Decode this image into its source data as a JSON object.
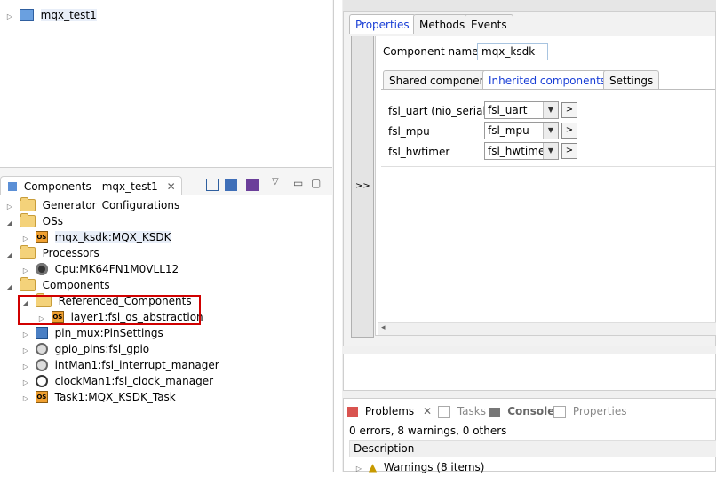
{
  "project_explorer": {
    "project": "mqx_test1"
  },
  "components_view": {
    "title": "Components - mqx_test1",
    "tree": [
      {
        "label": "Generator_Configurations",
        "icon": "folder-icon"
      },
      {
        "label": "OSs",
        "icon": "folder-icon"
      },
      {
        "label": "mqx_ksdk:MQX_KSDK",
        "icon": "os-component-icon"
      },
      {
        "label": "Processors",
        "icon": "folder-icon"
      },
      {
        "label": "Cpu:MK64FN1M0VLL12",
        "icon": "cpu-icon"
      },
      {
        "label": "Components",
        "icon": "folder-icon"
      },
      {
        "label": "Referenced_Components",
        "icon": "folder-icon"
      },
      {
        "label": "layer1:fsl_os_abstraction",
        "icon": "os-component-icon"
      },
      {
        "label": "pin_mux:PinSettings",
        "icon": "pin-icon"
      },
      {
        "label": "gpio_pins:fsl_gpio",
        "icon": "gpio-icon"
      },
      {
        "label": "intMan1:fsl_interrupt_manager",
        "icon": "interrupt-icon"
      },
      {
        "label": "clockMan1:fsl_clock_manager",
        "icon": "clock-icon"
      },
      {
        "label": "Task1:MQX_KSDK_Task",
        "icon": "os-component-icon"
      }
    ]
  },
  "inspector": {
    "tabs": [
      "Properties",
      "Methods",
      "Events"
    ],
    "side_button": ">>",
    "component_name_label": "Component name",
    "component_name_value": "mqx_ksdk",
    "subtabs": [
      "Shared components",
      "Inherited components",
      "Settings"
    ],
    "rows": [
      {
        "label": "fsl_uart (nio_serial)",
        "value": "fsl_uart",
        "button": ">"
      },
      {
        "label": "fsl_mpu",
        "value": "fsl_mpu",
        "button": ">"
      },
      {
        "label": "fsl_hwtimer",
        "value": "fsl_hwtimer",
        "button": ">"
      }
    ]
  },
  "problems": {
    "tabs": [
      "Problems",
      "Tasks",
      "Console",
      "Properties"
    ],
    "summary": "0 errors, 8 warnings, 0 others",
    "column": "Description",
    "row": "Warnings (8 items)"
  },
  "colors": {
    "highlight_box": "#d00000",
    "active_tab_text": "#1a3fd6"
  }
}
